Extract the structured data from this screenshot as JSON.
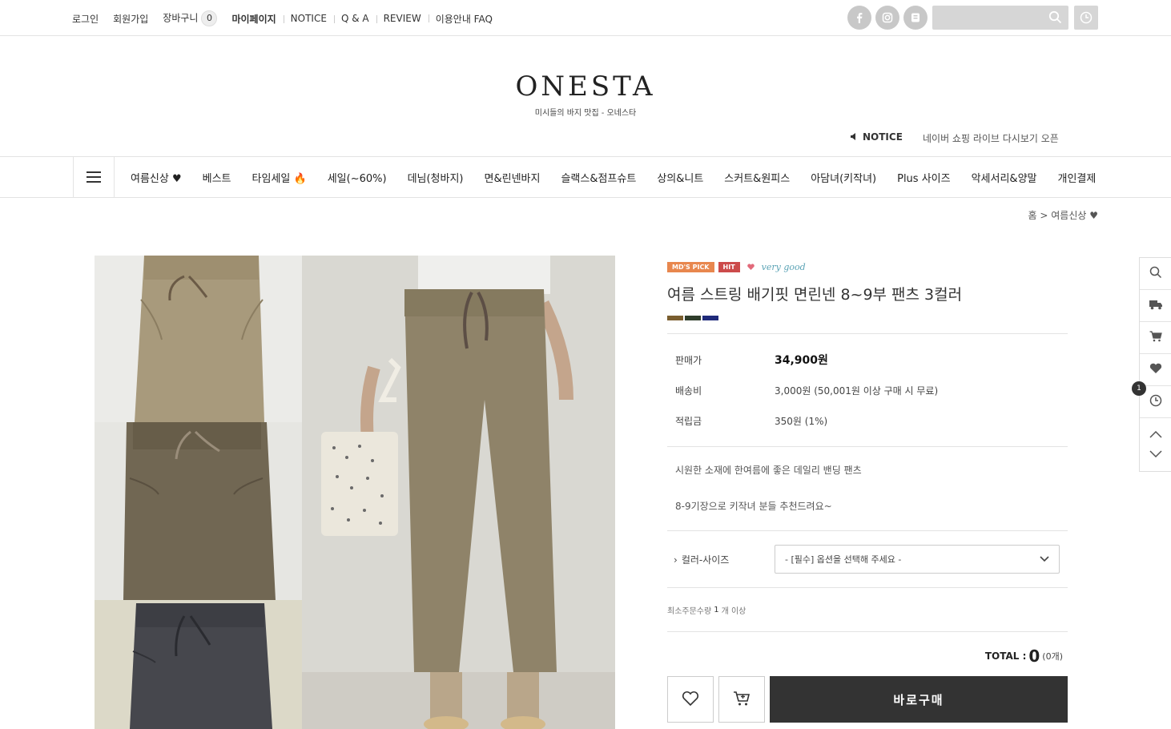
{
  "topbar": {
    "links": [
      "로그인",
      "회원가입",
      "장바구니",
      "마이페이지",
      "NOTICE",
      "Q & A",
      "REVIEW",
      "이용안내 FAQ"
    ],
    "cart_count": "0"
  },
  "brand": {
    "logo": "ONESTA",
    "tagline": "미시들의 바지 맛집 - 오네스타",
    "notice_label": "NOTICE",
    "notice_text": "네이버 쇼핑 라이브 다시보기 오픈"
  },
  "nav": {
    "items": [
      "여름신상 ♥",
      "베스트",
      "타임세일 🔥",
      "세일(~60%)",
      "데님(청바지)",
      "면&린넨바지",
      "슬랙스&점프슈트",
      "상의&니트",
      "스커트&원피스",
      "아담녀(키작녀)",
      "Plus 사이즈",
      "악세서리&양말",
      "개인결제"
    ]
  },
  "breadcrumb": {
    "home": "홈",
    "sep": ">",
    "current": "여름신상 ♥"
  },
  "product": {
    "badges": [
      "MD'S PICK",
      "HIT"
    ],
    "very_good": "very good",
    "title": "여름 스트링 배기핏 면린넨 8~9부 팬츠 3컬러",
    "swatches": [
      "#7a5e2f",
      "#2f3d2b",
      "#1f2a7a"
    ],
    "price_label": "판매가",
    "price": "34,900원",
    "shipping_label": "배송비",
    "shipping": "3,000원 (50,001원 이상 구매 시 무료)",
    "points_label": "적립금",
    "points": "350원 (1%)",
    "desc1": "시원한 소재에 한여름에 좋은 데일리 밴딩 팬츠",
    "desc2": "8-9기장으로 키작녀 분들 추천드려요~",
    "option_label": "컬러-사이즈",
    "option_placeholder": "- [필수] 옵션을 선택해 주세요 -",
    "min_order_label": "최소주문수량",
    "min_order_qty": "1",
    "min_order_suffix": "개 이상",
    "total_label": "TOTAL :",
    "total_value": "0",
    "total_count": "(0개)",
    "buy_label": "바로구매"
  },
  "quick": {
    "recent_count": "1"
  }
}
